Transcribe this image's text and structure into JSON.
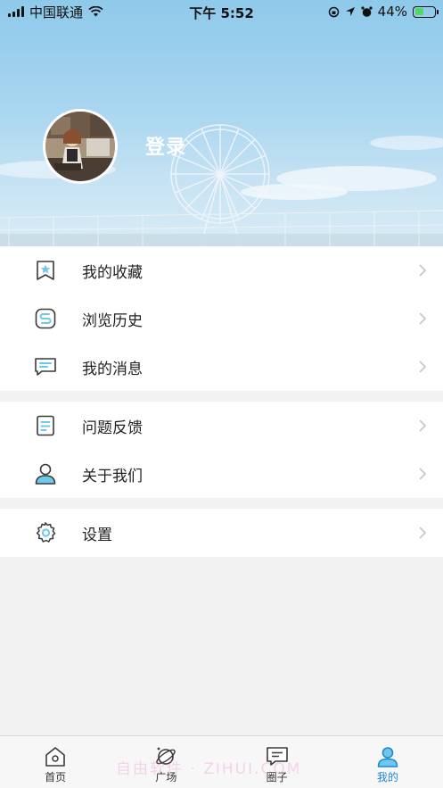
{
  "status_bar": {
    "carrier": "中国联通",
    "time": "下午 5:52",
    "battery_percent": "44%",
    "battery_level": 0.44,
    "icons": [
      "signal-icon",
      "wifi-icon",
      "orientation-lock-icon",
      "location-icon",
      "alarm-icon",
      "battery-icon"
    ]
  },
  "profile": {
    "login_label": "登录",
    "avatar_icon": "user-avatar"
  },
  "menu": {
    "group1": [
      {
        "label": "我的收藏",
        "icon": "bookmark-star-icon"
      },
      {
        "label": "浏览历史",
        "icon": "history-icon"
      },
      {
        "label": "我的消息",
        "icon": "message-icon"
      }
    ],
    "group2": [
      {
        "label": "问题反馈",
        "icon": "feedback-icon"
      },
      {
        "label": "关于我们",
        "icon": "person-icon"
      }
    ],
    "group3": [
      {
        "label": "设置",
        "icon": "gear-icon"
      }
    ]
  },
  "tabbar": {
    "tabs": [
      {
        "label": "首页",
        "icon": "home-icon",
        "active": false
      },
      {
        "label": "广场",
        "icon": "planet-icon",
        "active": false
      },
      {
        "label": "圈子",
        "icon": "chat-icon",
        "active": false
      },
      {
        "label": "我的",
        "icon": "profile-icon",
        "active": true
      }
    ],
    "active_color": "#1e88d0"
  },
  "watermark": "自由软件 · ZIHUI.COM",
  "colors": {
    "icon_accent": "#6ec8ec",
    "icon_stroke": "#3a3a3a",
    "chevron": "#c4c4c4"
  }
}
